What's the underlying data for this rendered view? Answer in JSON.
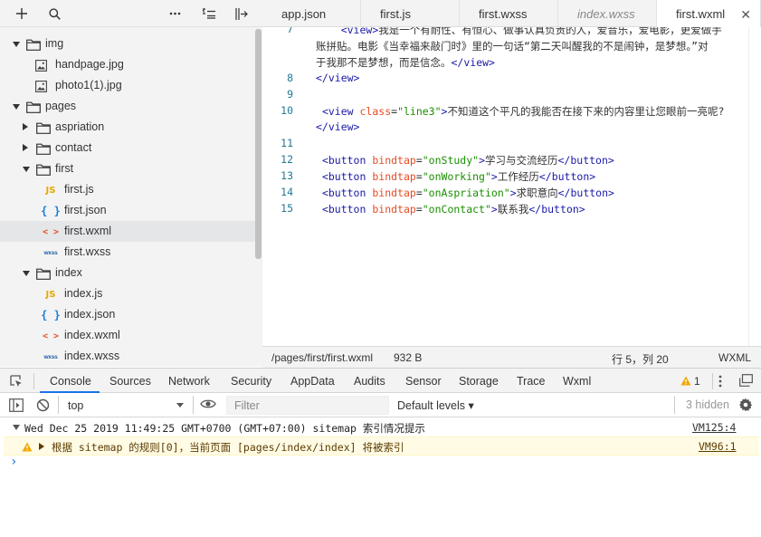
{
  "explorer": {
    "toolbar": {
      "add_icon": "plus-icon",
      "search_icon": "search-icon",
      "more_icon": "ellipsis-icon",
      "collapse_icon": "collapse-icon",
      "split_icon": "split-icon"
    },
    "tree": [
      {
        "label": "img",
        "type": "folder",
        "expanded": true,
        "depth": 0
      },
      {
        "label": "handpage.jpg",
        "type": "image",
        "depth": 1
      },
      {
        "label": "photo1(1).jpg",
        "type": "image",
        "depth": 1
      },
      {
        "label": "pages",
        "type": "folder",
        "expanded": true,
        "depth": 0
      },
      {
        "label": "aspriation",
        "type": "folder",
        "expanded": false,
        "depth": 1
      },
      {
        "label": "contact",
        "type": "folder",
        "expanded": false,
        "depth": 1
      },
      {
        "label": "first",
        "type": "folder",
        "expanded": true,
        "depth": 1
      },
      {
        "label": "first.js",
        "type": "js",
        "depth": 2
      },
      {
        "label": "first.json",
        "type": "json",
        "depth": 2
      },
      {
        "label": "first.wxml",
        "type": "wxml",
        "depth": 2,
        "selected": true
      },
      {
        "label": "first.wxss",
        "type": "wxss",
        "depth": 2
      },
      {
        "label": "index",
        "type": "folder",
        "expanded": true,
        "depth": 1
      },
      {
        "label": "index.js",
        "type": "js",
        "depth": 2
      },
      {
        "label": "index.json",
        "type": "json",
        "depth": 2
      },
      {
        "label": "index.wxml",
        "type": "wxml",
        "depth": 2
      },
      {
        "label": "index.wxss",
        "type": "wxss",
        "depth": 2
      }
    ],
    "icon_glyphs": {
      "js": "JS",
      "json": "{ }",
      "wxml": "< >",
      "wxss": "wxss"
    }
  },
  "editor": {
    "tabs": [
      {
        "label": "app.json",
        "italic": false,
        "active": false
      },
      {
        "label": "first.js",
        "italic": false,
        "active": false
      },
      {
        "label": "first.wxss",
        "italic": false,
        "active": false
      },
      {
        "label": "index.wxss",
        "italic": true,
        "active": false
      },
      {
        "label": "first.wxml",
        "italic": false,
        "active": true
      }
    ],
    "close_glyph": "✕",
    "lines": [
      {
        "num": "7",
        "html": "    <span class='t'>&lt;view&gt;</span>我是一个有耐性、有恒心、做事认真负责的人，爱音乐，爱电影，更爱做手",
        "partial": true
      },
      {
        "num": "",
        "html": "账拼贴。电影《当幸福来敲门时》里的一句话“第二天叫醒我的不是闹钟，是梦想。”对"
      },
      {
        "num": "",
        "html": "于我那不是梦想，而是信念。<span class='t'>&lt;/view&gt;</span>"
      },
      {
        "num": "8",
        "html": "<span class='t'>&lt;/view&gt;</span>"
      },
      {
        "num": "9",
        "html": ""
      },
      {
        "num": "10",
        "html": " <span class='t'>&lt;view</span> <span class='a'>class</span>=<span class='s'>\"line3\"</span><span class='t'>&gt;</span>不知道这个平凡的我能否在接下来的内容里让您眼前一亮呢?"
      },
      {
        "num": "",
        "html": "<span class='t'>&lt;/view&gt;</span>"
      },
      {
        "num": "11",
        "html": ""
      },
      {
        "num": "12",
        "html": " <span class='t'>&lt;button</span> <span class='a'>bindtap</span>=<span class='s'>\"onStudy\"</span><span class='t'>&gt;</span>学习与交流经历<span class='t'>&lt;/button&gt;</span>"
      },
      {
        "num": "13",
        "html": " <span class='t'>&lt;button</span> <span class='a'>bindtap</span>=<span class='s'>\"onWorking\"</span><span class='t'>&gt;</span>工作经历<span class='t'>&lt;/button&gt;</span>"
      },
      {
        "num": "14",
        "html": " <span class='t'>&lt;button</span> <span class='a'>bindtap</span>=<span class='s'>\"onAspriation\"</span><span class='t'>&gt;</span>求职意向<span class='t'>&lt;/button&gt;</span>"
      },
      {
        "num": "15",
        "html": " <span class='t'>&lt;button</span> <span class='a'>bindtap</span>=<span class='s'>\"onContact\"</span><span class='t'>&gt;</span>联系我<span class='t'>&lt;/button&gt;</span>"
      }
    ]
  },
  "status": {
    "path": "/pages/first/first.wxml",
    "size": "932 B",
    "position": "行 5，列 20",
    "language": "WXML"
  },
  "devtools": {
    "tabs": [
      "Console",
      "Sources",
      "Network",
      "Security",
      "AppData",
      "Audits",
      "Sensor",
      "Storage",
      "Trace",
      "Wxml"
    ],
    "active_tab": "Console",
    "warning_count": "1",
    "context": "top",
    "filter_placeholder": "Filter",
    "levels": "Default levels ▾",
    "hidden": "3 hidden",
    "console": {
      "group_header": "Wed Dec 25 2019 11:49:25 GMT+0700 (GMT+07:00) sitemap 索引情况提示",
      "group_link": "VM125:4",
      "warning_text": "根据 sitemap 的规则[0]，当前页面 [pages/index/index] 将被索引",
      "warning_link": "VM96:1",
      "prompt": "›"
    },
    "colors": {
      "accent": "#1a73e8",
      "warning_bg": "#fffbe5",
      "warning_border": "#fff5c2",
      "warning_text": "#5c3c00",
      "warning_icon": "#f2a600"
    }
  }
}
